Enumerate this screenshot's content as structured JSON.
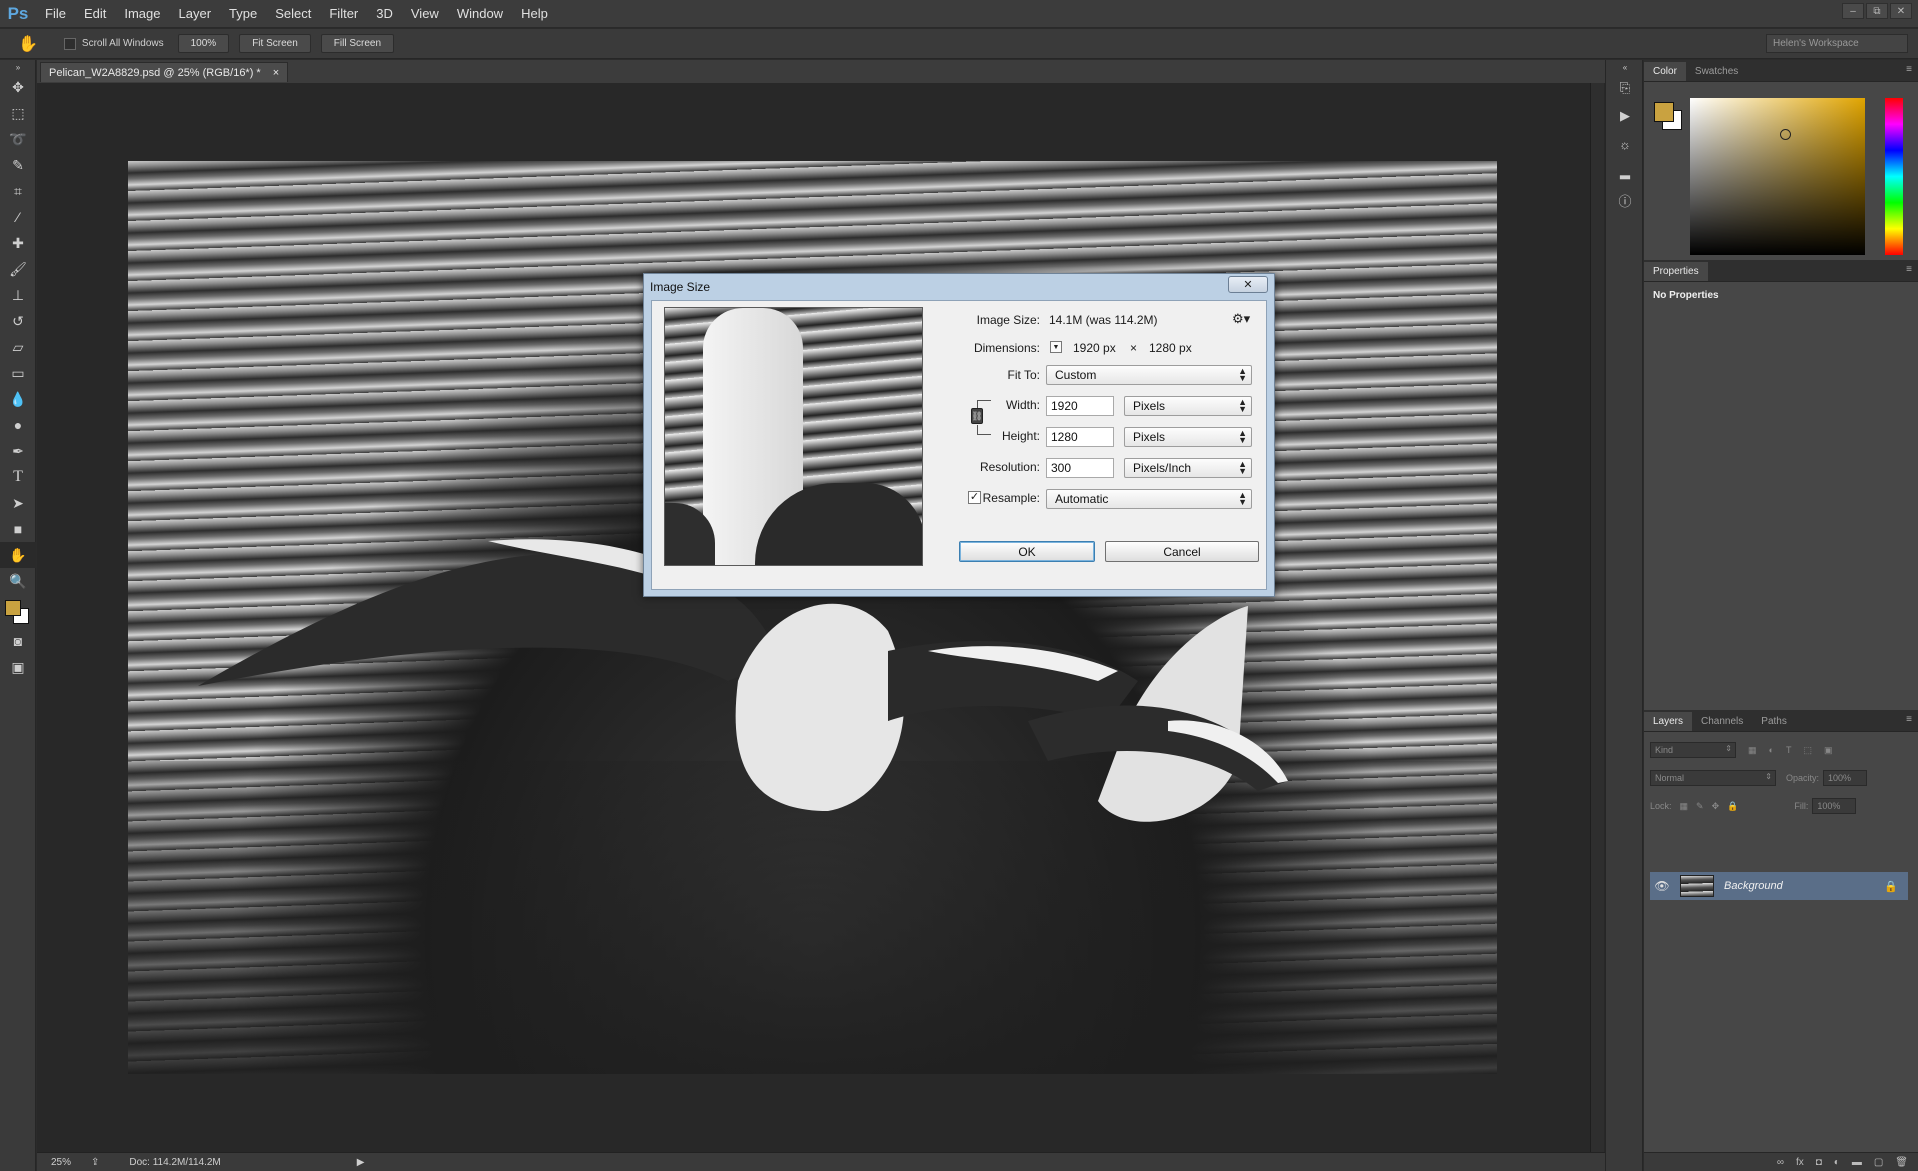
{
  "app": {
    "logo": "Ps",
    "menu": [
      "File",
      "Edit",
      "Image",
      "Layer",
      "Type",
      "Select",
      "Filter",
      "3D",
      "View",
      "Window",
      "Help"
    ],
    "window_controls": [
      "–",
      "⧉",
      "✕"
    ]
  },
  "options_bar": {
    "scroll_all_windows_label": "Scroll All Windows",
    "zoom_100_label": "100%",
    "fit_screen_label": "Fit Screen",
    "fill_screen_label": "Fill Screen",
    "workspace": "Helen's Workspace"
  },
  "document": {
    "tab_title": "Pelican_W2A8829.psd @ 25% (RGB/16*) *",
    "tab_close": "×"
  },
  "status_bar": {
    "zoom": "25%",
    "doc_info": "Doc: 114.2M/114.2M"
  },
  "dialog": {
    "title": "Image Size",
    "close_glyph": "✕",
    "image_size_label": "Image Size:",
    "image_size_value": "14.1M (was 114.2M)",
    "dimensions_label": "Dimensions:",
    "dimensions_width": "1920 px",
    "dimensions_x": "×",
    "dimensions_height": "1280 px",
    "fit_to_label": "Fit To:",
    "fit_to_value": "Custom",
    "width_label": "Width:",
    "width_value": "1920",
    "width_unit": "Pixels",
    "height_label": "Height:",
    "height_value": "1280",
    "height_unit": "Pixels",
    "resolution_label": "Resolution:",
    "resolution_value": "300",
    "resolution_unit": "Pixels/Inch",
    "resample_label": "Resample:",
    "resample_checked": true,
    "resample_value": "Automatic",
    "ok_label": "OK",
    "cancel_label": "Cancel"
  },
  "panels": {
    "color_tabs": [
      "Color",
      "Swatches"
    ],
    "foreground_color": "#c9a240",
    "background_color": "#ffffff",
    "properties_tab": "Properties",
    "properties_text": "No Properties",
    "layers_tabs": [
      "Layers",
      "Channels",
      "Paths"
    ],
    "kind_filter": "Kind",
    "blend_mode": "Normal",
    "opacity_label": "Opacity:",
    "opacity_value": "100%",
    "lock_label": "Lock:",
    "fill_label": "Fill:",
    "fill_value": "100%",
    "layers": [
      {
        "name": "Background",
        "visible": true,
        "locked": true
      }
    ]
  }
}
